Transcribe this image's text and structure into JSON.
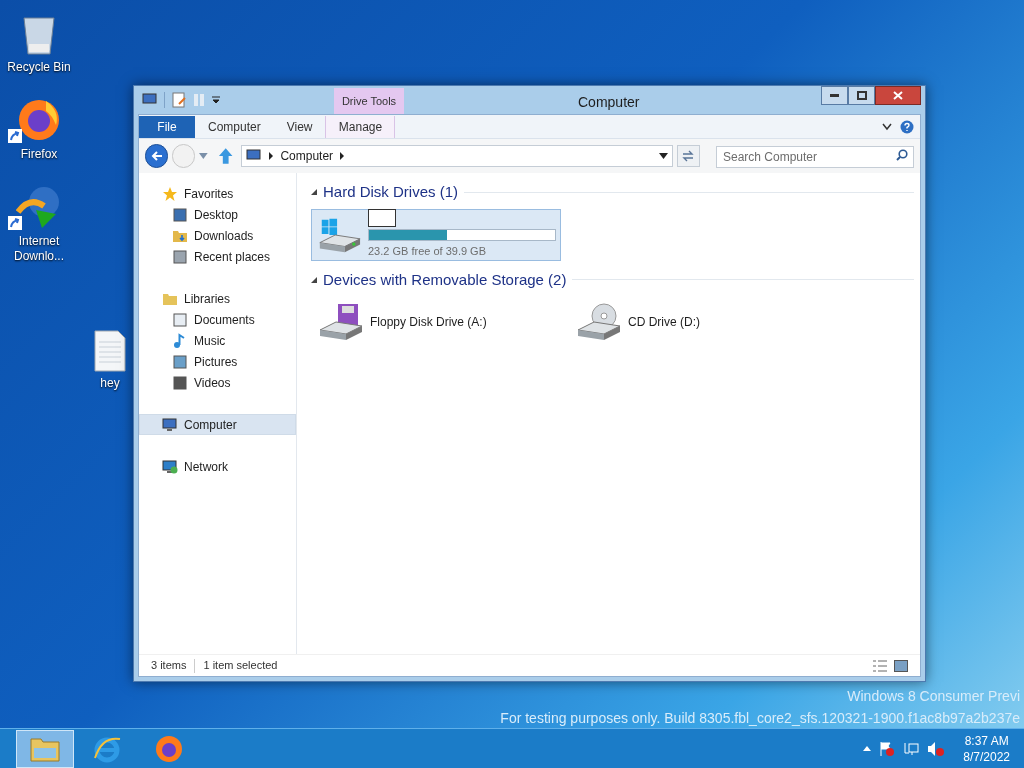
{
  "desktop_icons": [
    {
      "label": "Recycle Bin",
      "kind": "bin",
      "shortcut": false
    },
    {
      "label": "Firefox",
      "kind": "firefox",
      "shortcut": true
    },
    {
      "label": "Internet Downlo...",
      "kind": "idm",
      "shortcut": true
    },
    {
      "label": "hey",
      "kind": "file",
      "shortcut": false
    }
  ],
  "window": {
    "title": "Computer",
    "contextual_group": "Drive Tools",
    "tabs": [
      {
        "label": "File",
        "kind": "file",
        "selected": false
      },
      {
        "label": "Computer",
        "kind": "tab",
        "selected": false
      },
      {
        "label": "View",
        "kind": "tab",
        "selected": false
      },
      {
        "label": "Manage",
        "kind": "context",
        "selected": false
      }
    ],
    "address": {
      "crumb": "Computer"
    },
    "search": {
      "placeholder": "Search Computer"
    },
    "nav": [
      {
        "label": "Favorites",
        "kind": "star",
        "selected": false,
        "children": [
          {
            "label": "Desktop",
            "kind": "desktop",
            "selected": false
          },
          {
            "label": "Downloads",
            "kind": "downloads",
            "selected": false
          },
          {
            "label": "Recent places",
            "kind": "recent",
            "selected": false
          }
        ]
      },
      {
        "label": "Libraries",
        "kind": "libraries",
        "selected": false,
        "children": [
          {
            "label": "Documents",
            "kind": "documents",
            "selected": false
          },
          {
            "label": "Music",
            "kind": "music",
            "selected": false
          },
          {
            "label": "Pictures",
            "kind": "pictures",
            "selected": false
          },
          {
            "label": "Videos",
            "kind": "videos",
            "selected": false
          }
        ]
      },
      {
        "label": "Computer",
        "kind": "computer",
        "selected": true
      },
      {
        "label": "Network",
        "kind": "network",
        "selected": false
      }
    ],
    "groups": [
      {
        "title": "Hard Disk Drives (1)",
        "expanded": true,
        "items": [
          {
            "kind": "hdd",
            "selected": true,
            "level": 0.42,
            "reading": "23.2 GB free of 39.9 GB"
          }
        ]
      },
      {
        "title": "Devices with Removable Storage (2)",
        "expanded": true,
        "items": [
          {
            "kind": "floppy",
            "name": "Floppy Disk Drive (A:)",
            "selected": false
          },
          {
            "kind": "cd",
            "name": "CD Drive (D:)",
            "selected": false
          }
        ]
      }
    ],
    "status": {
      "count": "3 items",
      "selection": "1 item selected"
    }
  },
  "watermark": {
    "line_1": "Windows 8 Consumer Previ",
    "line_2": "For testing purposes only. Build 8305.fbl_core2_sfs.120321-1900.f1ac8b97a2b237e"
  },
  "taskbar": {
    "apps": [
      {
        "kind": "explorer",
        "selected": true
      },
      {
        "kind": "ie",
        "selected": false
      },
      {
        "kind": "firefox",
        "selected": false
      }
    ],
    "time": "8:37 AM",
    "date": "8/7/2022"
  }
}
